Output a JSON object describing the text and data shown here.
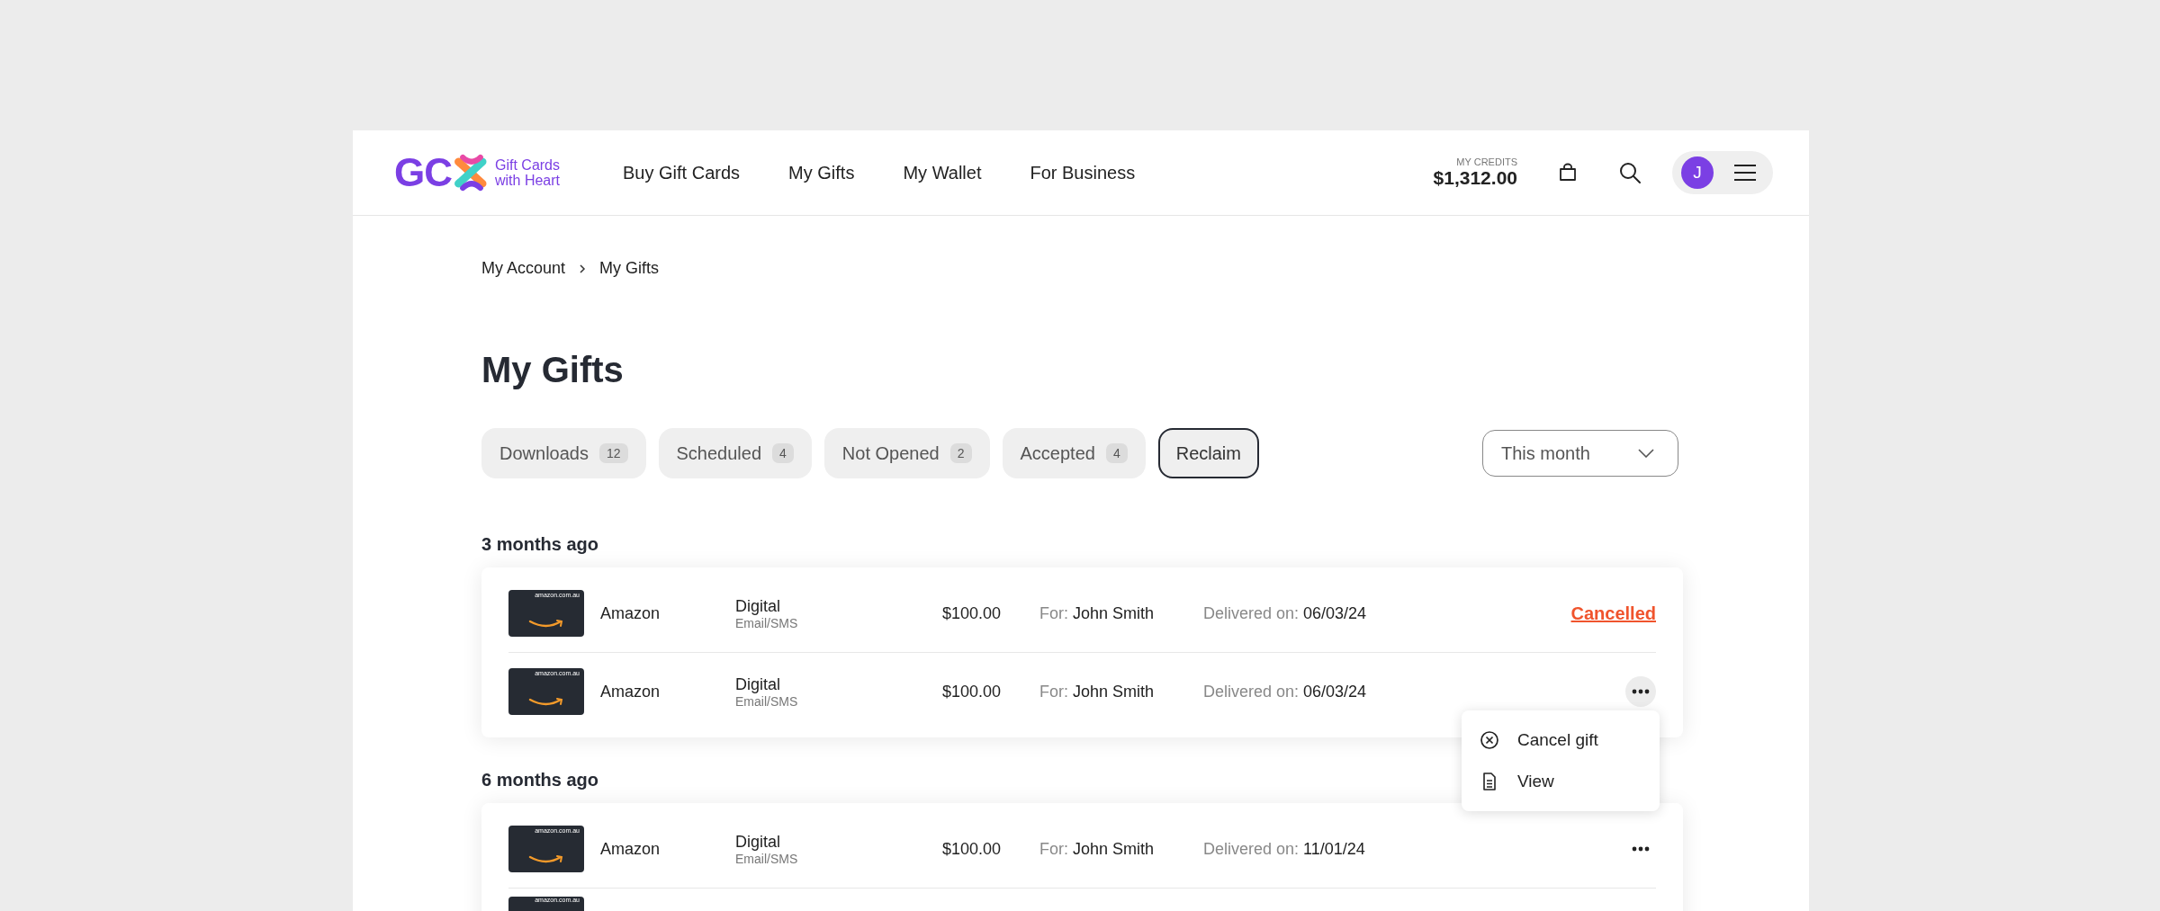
{
  "header": {
    "logo": {
      "letters": "GC",
      "tagline": [
        "Gift Cards",
        "with Heart"
      ]
    },
    "nav": [
      {
        "label": "Buy Gift Cards"
      },
      {
        "label": "My Gifts"
      },
      {
        "label": "My Wallet"
      },
      {
        "label": "For Business"
      }
    ],
    "credits": {
      "label": "MY CREDITS",
      "amount": "$1,312.00"
    },
    "avatar": {
      "initial": "J"
    }
  },
  "breadcrumb": [
    "My Account",
    "My Gifts"
  ],
  "title": "My Gifts",
  "tabs": [
    {
      "label": "Downloads",
      "count": "12",
      "selected": false
    },
    {
      "label": "Scheduled",
      "count": "4",
      "selected": false
    },
    {
      "label": "Not Opened",
      "count": "2",
      "selected": false
    },
    {
      "label": "Accepted",
      "count": "4",
      "selected": false
    },
    {
      "label": "Reclaim",
      "selected": true
    }
  ],
  "period_select": {
    "value": "This month"
  },
  "groups": [
    {
      "heading": "3 months ago",
      "rows": [
        {
          "kind": "full",
          "card_text": "amazon.com.au",
          "name": "Amazon",
          "type": "Digital",
          "delivery": "Email/SMS",
          "price": "$100.00",
          "for_label": "For:",
          "recipient": "John Smith",
          "delivered_label": "Delivered on:",
          "date": "06/03/24",
          "action": {
            "kind": "status",
            "label": "Cancelled"
          }
        },
        {
          "kind": "full",
          "card_text": "amazon.com.au",
          "name": "Amazon",
          "type": "Digital",
          "delivery": "Email/SMS",
          "price": "$100.00",
          "for_label": "For:",
          "recipient": "John Smith",
          "delivered_label": "Delivered on:",
          "date": "06/03/24",
          "action": {
            "kind": "menu",
            "open": true,
            "items": [
              {
                "kind": "cancel",
                "label": "Cancel gift"
              },
              {
                "kind": "view",
                "label": "View"
              }
            ]
          }
        }
      ]
    },
    {
      "heading": "6 months ago",
      "rows": [
        {
          "kind": "full",
          "card_text": "amazon.com.au",
          "name": "Amazon",
          "type": "Digital",
          "delivery": "Email/SMS",
          "price": "$100.00",
          "for_label": "For:",
          "recipient": "John Smith",
          "delivered_label": "Delivered on:",
          "date": "11/01/24",
          "action": {
            "kind": "menu",
            "open": false
          }
        },
        {
          "kind": "partial",
          "card_text": "amazon.com.au"
        }
      ]
    }
  ]
}
